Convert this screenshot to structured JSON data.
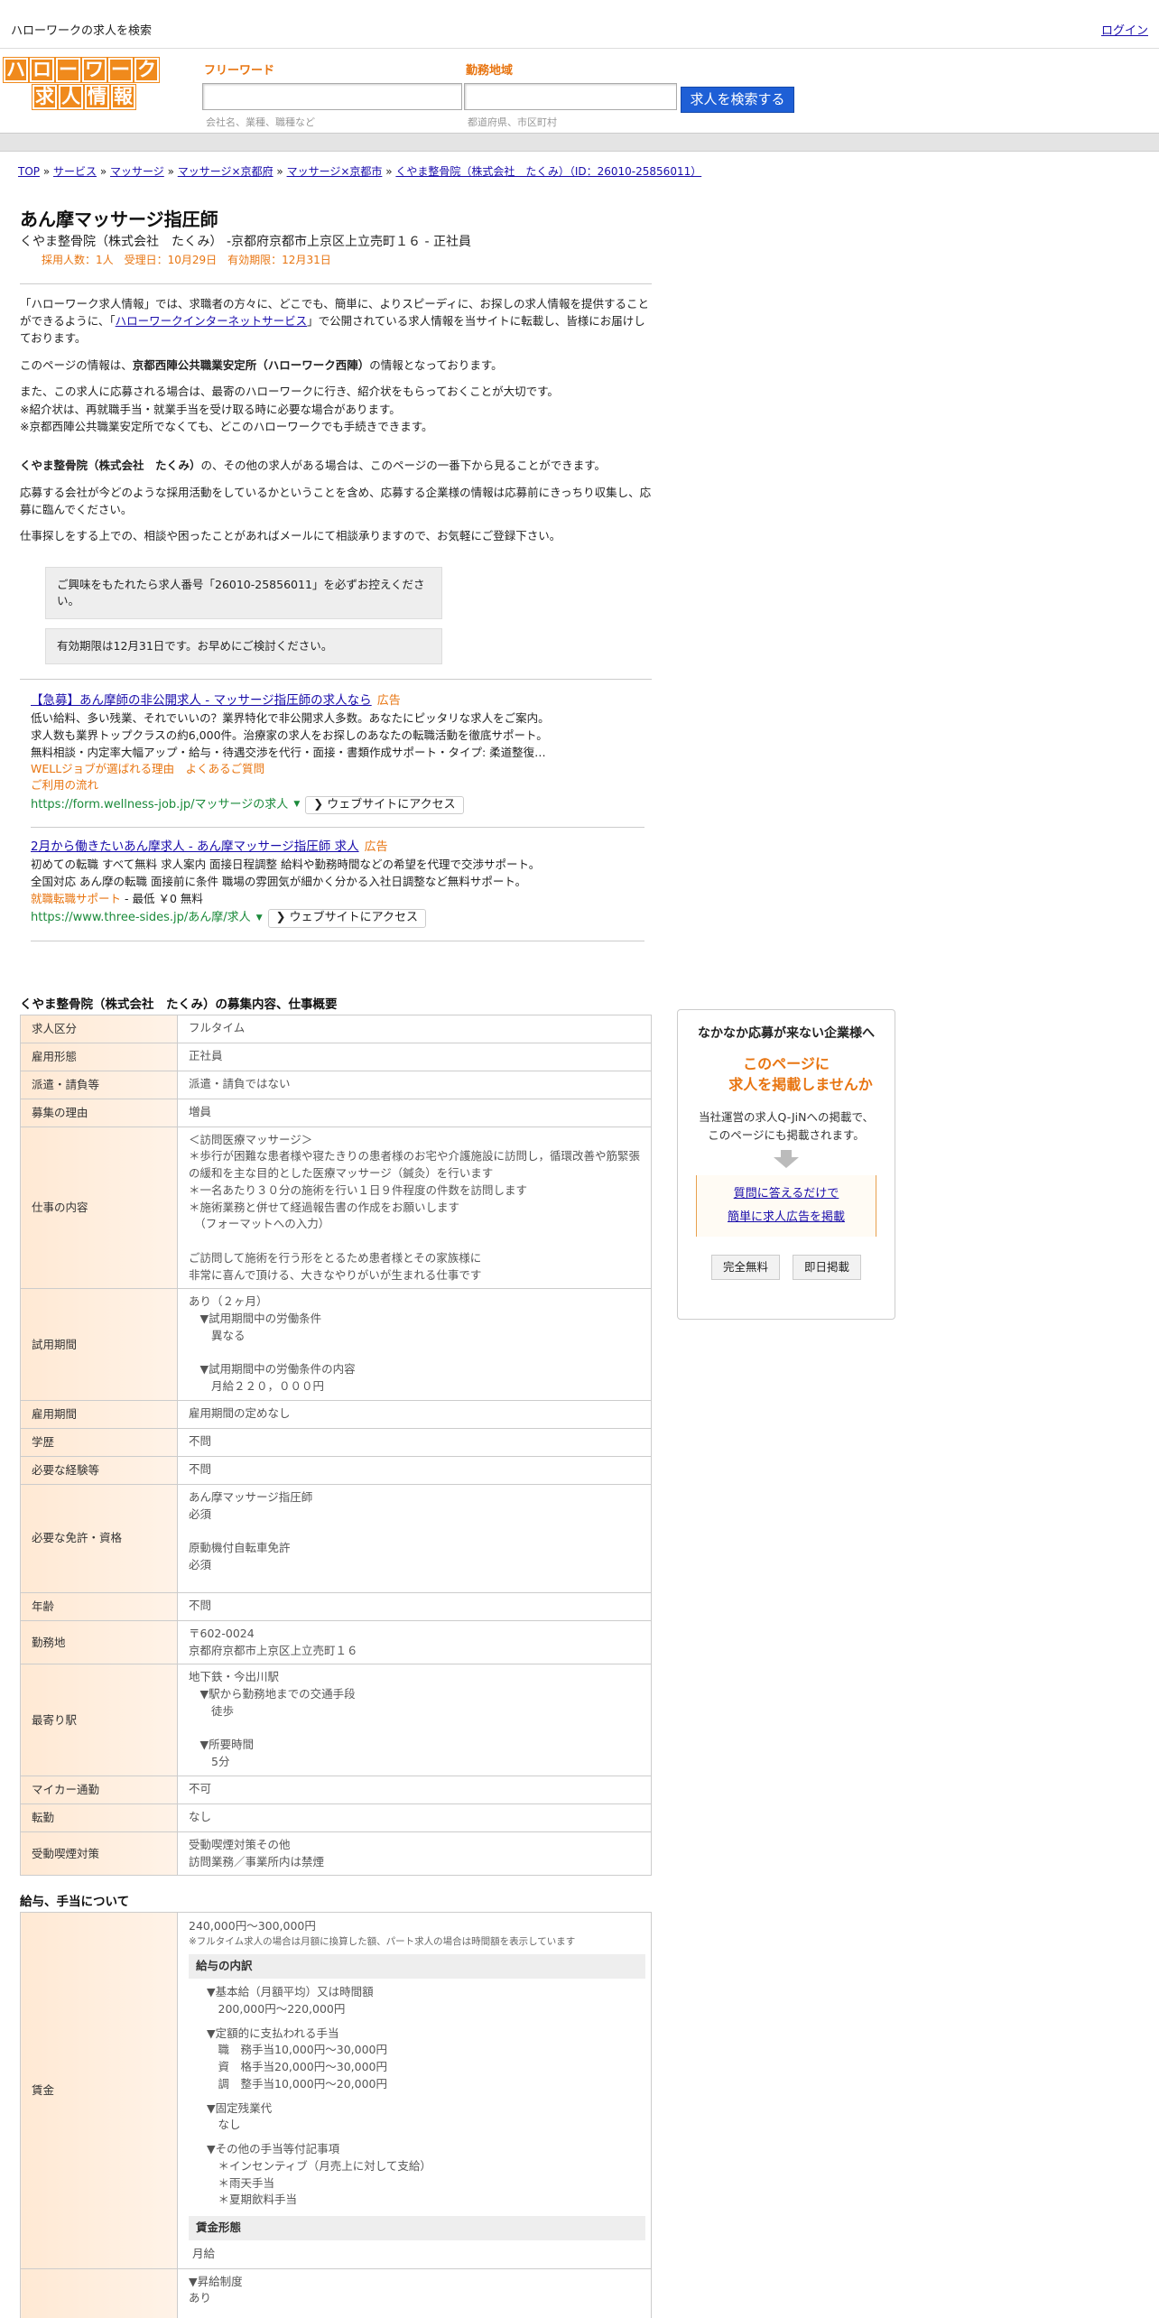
{
  "topbar": {
    "site_title": "ハローワークの求人を検索",
    "login": "ログイン"
  },
  "logo": {
    "row1": [
      "ハ",
      "ロ",
      "ー",
      "ワ",
      "ー",
      "ク"
    ],
    "row2": [
      "求",
      "人",
      "情",
      "報"
    ]
  },
  "search": {
    "keyword_label": "フリーワード",
    "keyword_placeholder": "会社名、業種、職種など",
    "area_label": "勤務地域",
    "area_placeholder": "都道府県、市区町村",
    "button": "求人を検索する"
  },
  "breadcrumb": [
    "TOP",
    "サービス",
    "マッサージ",
    "マッサージ×京都府",
    "マッサージ×京都市",
    "くやま整骨院（株式会社　たくみ）（ID：26010-25856011）"
  ],
  "job": {
    "title": "あん摩マッサージ指圧師",
    "company_line": "くやま整骨院（株式会社　たくみ） -京都府京都市上京区上立売町１６ - 正社員",
    "meta": "採用人数：1人　受理日：10月29日　有効期限：12月31日"
  },
  "intro": {
    "p1_a": "「ハローワーク求人情報」では、求職者の方々に、どこでも、簡単に、よりスピーディに、お探しの求人情報を提供することができるように、「",
    "p1_link": "ハローワークインターネットサービス",
    "p1_b": "」で公開されている求人情報を当サイトに転載し、皆様にお届けしております。",
    "p2_a": "このページの情報は、",
    "p2_bold": "京都西陣公共職業安定所（ハローワーク西陣）",
    "p2_b": "の情報となっております。",
    "p3": "また、この求人に応募される場合は、最寄のハローワークに行き、紹介状をもらっておくことが大切です。\n※紹介状は、再就職手当・就業手当を受け取る時に必要な場合があります。\n※京都西陣公共職業安定所でなくても、どこのハローワークでも手続きできます。",
    "p4_bold": "くやま整骨院（株式会社　たくみ）",
    "p4_b": "の、その他の求人がある場合は、このページの一番下から見ることができます。",
    "p5": "応募する会社が今どのような採用活動をしているかということを含め、応募する企業様の情報は応募前にきっちり収集し、応募に臨んでください。",
    "p6": "仕事探しをする上での、相談や困ったことがあればメールにて相談承りますので、お気軽にご登録下さい。",
    "notice1": "ご興味をもたれたら求人番号「26010-25856011」を必ずお控えください。",
    "notice2": "有効期限は12月31日です。お早めにご検討ください。"
  },
  "ads": [
    {
      "title": "【急募】あん摩師の非公開求人 - マッサージ指圧師の求人なら",
      "badge": "広告",
      "desc": "低い給料、多い残業、それでいいの？業界特化で非公開求人多数。あなたにピッタリな求人をご案内。\n求人数も業界トップクラスの約6,000件。治療家の求人をお探しのあなたの転職活動を徹底サポート。\n無料相談・内定率大幅アップ・給与・待遇交渉を代行・面接・書類作成サポート・タイプ: 柔道整復…",
      "links": "WELLジョブが選ばれる理由　よくあるご質問\nご利用の流れ",
      "url": "https://form.wellness-job.jp/マッサージの求人",
      "button": "ウェブサイトにアクセス"
    },
    {
      "title": "2月から働きたいあん摩求人 - あん摩マッサージ指圧師 求人",
      "badge": "広告",
      "desc": "初めての転職 すべて無料 求人案内 面接日程調整 給料や勤務時間などの希望を代理で交渉サポート。\n全国対応 あん摩の転職 面接前に条件 職場の雰囲気が細かく分かる入社日調整など無料サポート。",
      "links_orange": "就職転職サポート",
      "links_plain": " - 最低 ￥0 無料",
      "url": "https://www.three-sides.jp/あん摩/求人",
      "button": "ウェブサイトにアクセス"
    }
  ],
  "spec_section_title": "くやま整骨院（株式会社　たくみ）の募集内容、仕事概要",
  "spec_rows": [
    {
      "label": "求人区分",
      "value": "フルタイム"
    },
    {
      "label": "雇用形態",
      "value": "正社員"
    },
    {
      "label": "派遣・請負等",
      "value": "派遣・請負ではない"
    },
    {
      "label": "募集の理由",
      "value": "増員"
    },
    {
      "label": "仕事の内容",
      "value": "＜訪問医療マッサージ＞\n＊歩行が困難な患者様や寝たきりの患者様のお宅や介護施設に訪問し，循環改善や筋緊張の緩和を主な目的とした医療マッサージ（鍼灸）を行います\n＊一名あたり３０分の施術を行い１日９件程度の件数を訪問します\n＊施術業務と併せて経過報告書の作成をお願いします\n　（フォーマットへの入力）\n\nご訪問して施術を行う形をとるため患者様とその家族様に\n非常に喜んで頂ける、大きなやりがいが生まれる仕事です"
    },
    {
      "label": "試用期間",
      "value": "あり（２ヶ月）\n　▼試用期間中の労働条件\n　　異なる\n\n　▼試用期間中の労働条件の内容\n　　月給２２０，０００円"
    },
    {
      "label": "雇用期間",
      "value": "雇用期間の定めなし"
    },
    {
      "label": "学歴",
      "value": "不問"
    },
    {
      "label": "必要な経験等",
      "value": "不問"
    },
    {
      "label": "必要な免許・資格",
      "value": "あん摩マッサージ指圧師\n必須\n\n原動機付自転車免許\n必須\n "
    },
    {
      "label": "年齢",
      "value": "不問"
    },
    {
      "label": "勤務地",
      "value": "〒602-0024\n京都府京都市上京区上立売町１６"
    },
    {
      "label": "最寄り駅",
      "value": "地下鉄・今出川駅\n　▼駅から勤務地までの交通手段\n　　徒歩\n\n　▼所要時間\n　　5分"
    },
    {
      "label": "マイカー通勤",
      "value": "不可"
    },
    {
      "label": "転勤",
      "value": "なし"
    },
    {
      "label": "受動喫煙対策",
      "value": "受動喫煙対策その他\n訪問業務／事業所内は禁煙"
    }
  ],
  "wage_section_title": "給与、手当について",
  "wage": {
    "label": "賃金",
    "range": "240,000円〜300,000円",
    "note": "※フルタイム求人の場合は月額に換算した額、パート求人の場合は時間額を表示しています",
    "breakdown_head": "給与の内訳",
    "base": "▼基本給（月額平均）又は時間額\n　200,000円〜220,000円",
    "fixed": "▼定額的に支払われる手当\n　職　務手当10,000円〜30,000円\n　資　格手当20,000円〜30,000円\n　調　整手当10,000円〜20,000円",
    "overtime": "▼固定残業代\n　なし",
    "other": "▼その他の手当等付記事項\n　＊インセンティブ（月売上に対して支給）\n　＊雨天手当\n　＊夏期飲料手当",
    "form_head": "賃金形態",
    "form": "月給",
    "raise": "▼昇給制度\nあり"
  },
  "sidebox": {
    "title": "なかなか応募が来ない企業様へ",
    "emph": "このページに\n　　求人を掲載しませんか",
    "text": "当社運営の求人Q-JiNへの掲載で、\nこのページにも掲載されます。",
    "cta1": "質問に答えるだけで",
    "cta2": "簡単に求人広告を掲載",
    "btn1": "完全無料",
    "btn2": "即日掲載"
  }
}
